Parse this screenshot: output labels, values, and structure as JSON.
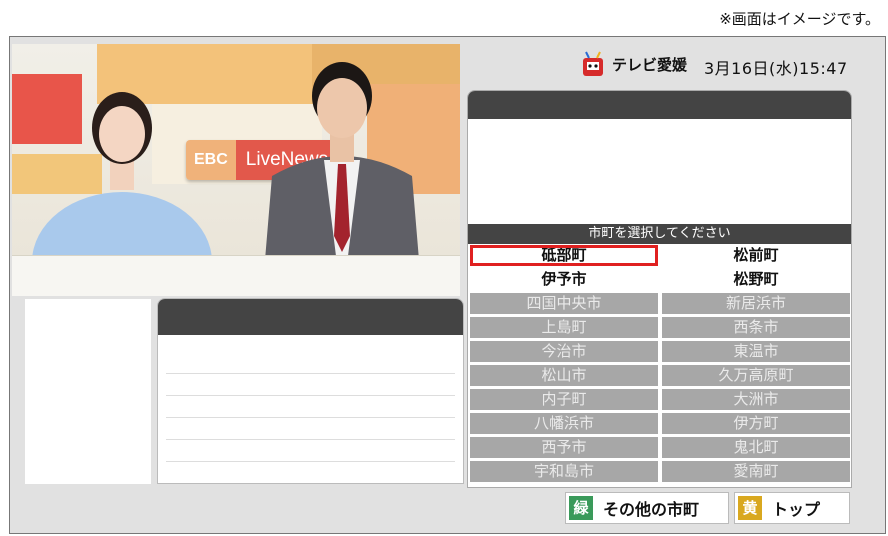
{
  "note": "※画面はイメージです。",
  "header": {
    "brand": "テレビ愛媛",
    "datetime": "3月16日(水)15:47"
  },
  "video": {
    "sign_ebc": "EBC",
    "sign_live": "LiveNews"
  },
  "select": {
    "title": "市町を選択してください",
    "cells": [
      {
        "label": "砥部町",
        "state": "active",
        "selected": true
      },
      {
        "label": "松前町",
        "state": "active",
        "selected": false
      },
      {
        "label": "伊予市",
        "state": "active",
        "selected": false
      },
      {
        "label": "松野町",
        "state": "active",
        "selected": false
      },
      {
        "label": "四国中央市",
        "state": "inactive",
        "selected": false
      },
      {
        "label": "新居浜市",
        "state": "inactive",
        "selected": false
      },
      {
        "label": "上島町",
        "state": "inactive",
        "selected": false
      },
      {
        "label": "西条市",
        "state": "inactive",
        "selected": false
      },
      {
        "label": "今治市",
        "state": "inactive",
        "selected": false
      },
      {
        "label": "東温市",
        "state": "inactive",
        "selected": false
      },
      {
        "label": "松山市",
        "state": "inactive",
        "selected": false
      },
      {
        "label": "久万高原町",
        "state": "inactive",
        "selected": false
      },
      {
        "label": "内子町",
        "state": "inactive",
        "selected": false
      },
      {
        "label": "大洲市",
        "state": "inactive",
        "selected": false
      },
      {
        "label": "八幡浜市",
        "state": "inactive",
        "selected": false
      },
      {
        "label": "伊方町",
        "state": "inactive",
        "selected": false
      },
      {
        "label": "西予市",
        "state": "inactive",
        "selected": false
      },
      {
        "label": "鬼北町",
        "state": "inactive",
        "selected": false
      },
      {
        "label": "宇和島市",
        "state": "inactive",
        "selected": false
      },
      {
        "label": "愛南町",
        "state": "inactive",
        "selected": false
      }
    ]
  },
  "keys": {
    "green": {
      "badge": "緑",
      "label": "その他の市町",
      "color": "#3a9a5a"
    },
    "yellow": {
      "badge": "黄",
      "label": "トップ",
      "color": "#d9a81f"
    }
  }
}
